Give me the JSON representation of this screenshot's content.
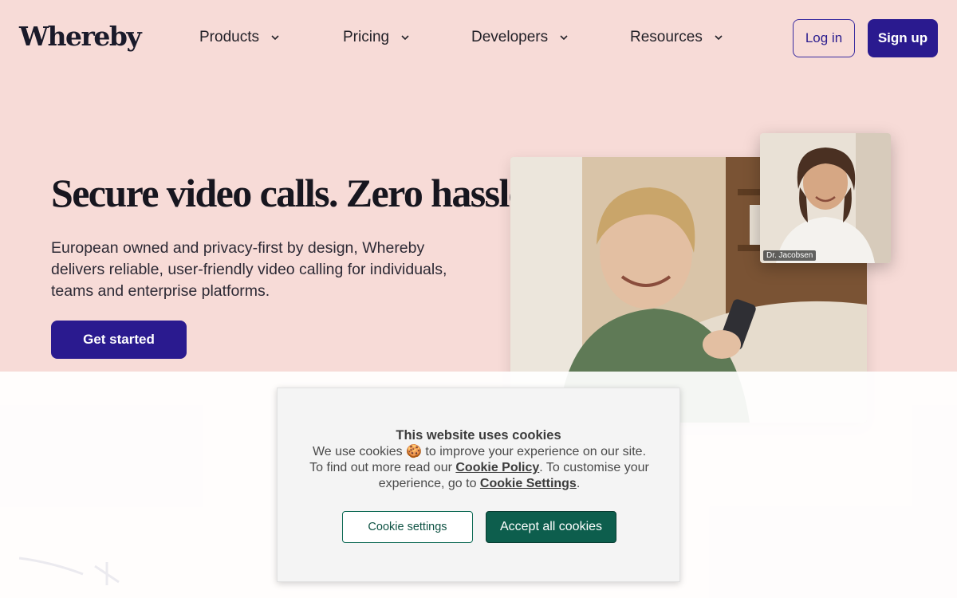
{
  "header": {
    "logo": "Whereby",
    "nav": [
      {
        "label": "Products"
      },
      {
        "label": "Pricing"
      },
      {
        "label": "Developers"
      },
      {
        "label": "Resources"
      }
    ],
    "login_label": "Log in",
    "signup_label": "Sign up"
  },
  "hero": {
    "title": "Secure video calls. Zero hassle",
    "description": "European owned and privacy-first by design, Whereby delivers reliable, user-friendly video calling for individuals, teams and enterprise platforms.",
    "cta_label": "Get started",
    "pip_name": "Dr. Jacobsen"
  },
  "cookie": {
    "title": "This website uses cookies",
    "line1": "We use cookies 🍪 to improve your experience on our site.",
    "line2_prefix": "To find out more read our ",
    "policy_link": "Cookie Policy",
    "line2_mid": ". To customise your experience, go to ",
    "settings_link": "Cookie Settings",
    "line2_suffix": ".",
    "settings_button": "Cookie settings",
    "accept_button": "Accept all cookies"
  },
  "colors": {
    "background": "#f7dbd7",
    "brand": "#2a1a8f",
    "accept": "#0d5e4d"
  }
}
